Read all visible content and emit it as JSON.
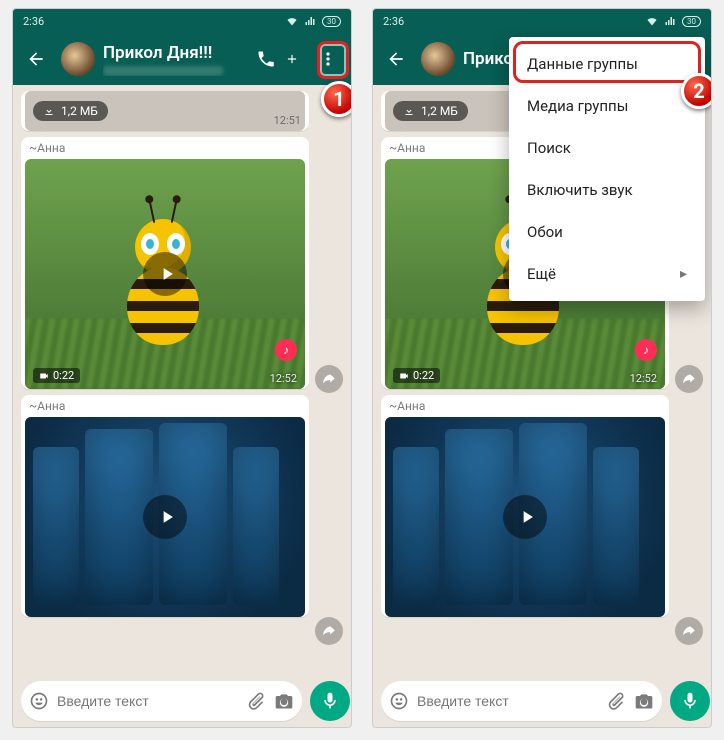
{
  "status": {
    "time": "2:36",
    "battery": "30"
  },
  "chat": {
    "title": "Прикол Дня!!!",
    "msg1": {
      "size_label": "1,2 МБ",
      "time": "12:51"
    },
    "msg2": {
      "sender": "~Анна",
      "duration": "0:22",
      "time": "12:52"
    },
    "msg3": {
      "sender": "~Анна"
    }
  },
  "input": {
    "placeholder": "Введите текст"
  },
  "menu": {
    "items": [
      "Данные группы",
      "Медиа группы",
      "Поиск",
      "Включить звук",
      "Обои",
      "Ещё"
    ]
  },
  "callouts": {
    "one": "1",
    "two": "2"
  }
}
